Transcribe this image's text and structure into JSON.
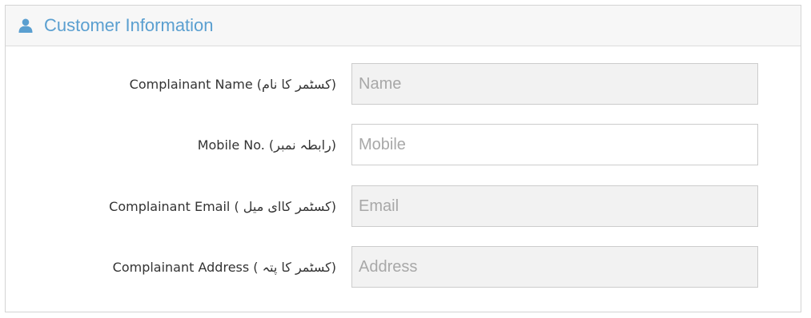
{
  "panel": {
    "title": "Customer Information",
    "icon": "user-icon",
    "accent_color": "#5a9fd0"
  },
  "fields": [
    {
      "label": "Complainant Name (کسٹمر کا نام)",
      "placeholder": "Name",
      "value": ""
    },
    {
      "label": "Mobile No. (رابطہ نمبر)",
      "placeholder": "Mobile",
      "value": ""
    },
    {
      "label": "Complainant Email ( کسٹمر کاای میل)",
      "placeholder": "Email",
      "value": ""
    },
    {
      "label": "Complainant Address ( کسٹمر کا پتہ)",
      "placeholder": "Address",
      "value": ""
    }
  ]
}
